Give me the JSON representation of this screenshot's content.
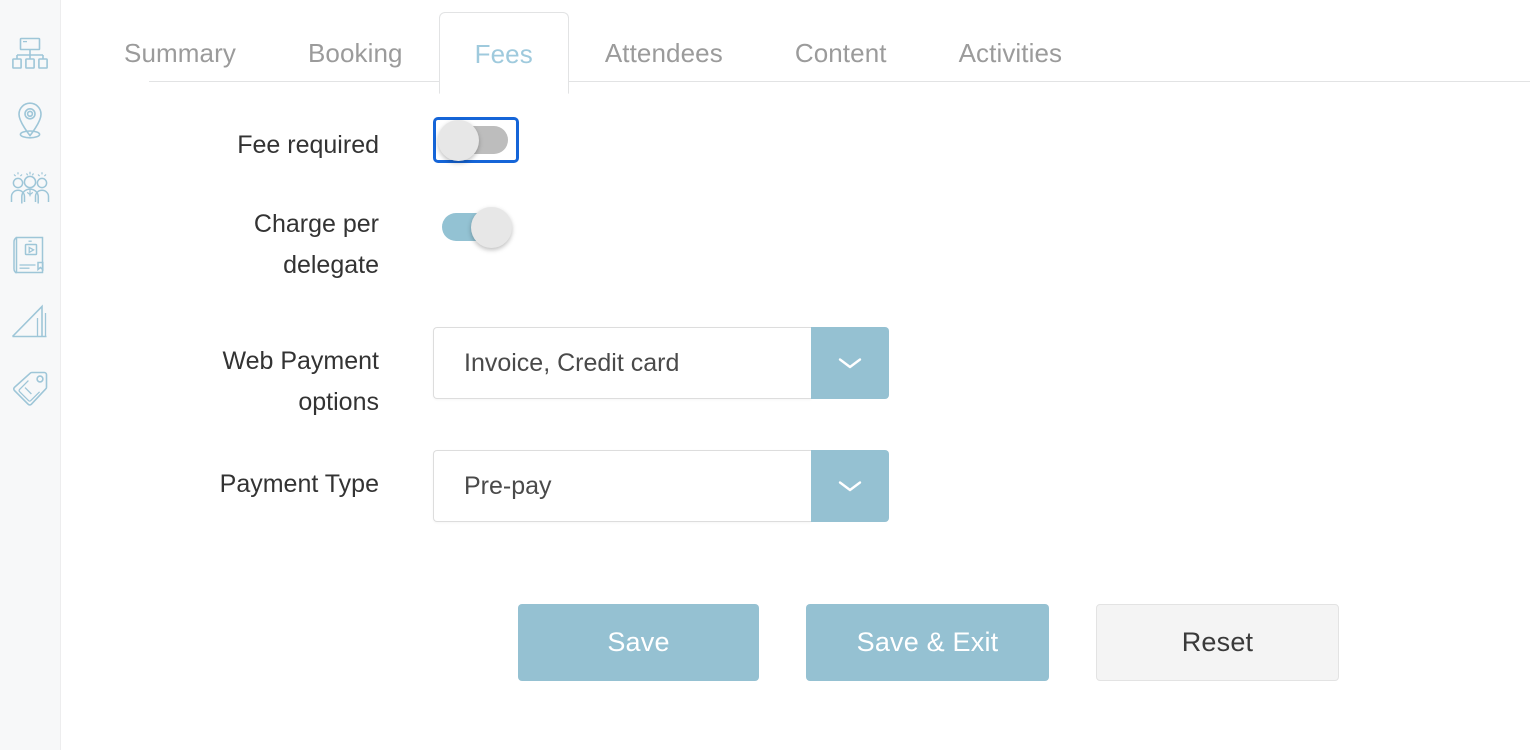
{
  "sidebar": {
    "items": [
      {
        "icon": "org-chart-icon",
        "name": "sidebar-item-structure"
      },
      {
        "icon": "map-pin-icon",
        "name": "sidebar-item-location"
      },
      {
        "icon": "people-group-icon",
        "name": "sidebar-item-attendees"
      },
      {
        "icon": "ebook-icon",
        "name": "sidebar-item-content"
      },
      {
        "icon": "ramp-chart-icon",
        "name": "sidebar-item-activities"
      },
      {
        "icon": "price-tag-icon",
        "name": "sidebar-item-fees"
      }
    ]
  },
  "tabs": {
    "items": [
      {
        "label": "Summary",
        "active": false
      },
      {
        "label": "Booking",
        "active": false
      },
      {
        "label": "Fees",
        "active": true
      },
      {
        "label": "Attendees",
        "active": false
      },
      {
        "label": "Content",
        "active": false
      },
      {
        "label": "Activities",
        "active": false
      }
    ],
    "active_label": "Fees"
  },
  "form": {
    "fee_required": {
      "label": "Fee required",
      "state": "off",
      "focused": true
    },
    "charge_per_delegate": {
      "label": "Charge per\ndelegate",
      "state": "on",
      "focused": false
    },
    "web_payment_options": {
      "label": "Web Payment\noptions",
      "value": "Invoice, Credit card",
      "chevron": "chevron-down-icon"
    },
    "payment_type": {
      "label": "Payment Type",
      "value": "Pre-pay",
      "chevron": "chevron-down-icon"
    }
  },
  "actions": {
    "save": "Save",
    "save_exit": "Save & Exit",
    "reset": "Reset"
  },
  "colors": {
    "accent": "#95c1d2",
    "tab_active_text": "#9fcadd",
    "focus_ring": "#1565d8",
    "toggle_off_track": "#bdbdbd",
    "toggle_on_track": "#93c2d3",
    "sidebar_bg": "#f7f8f9",
    "text_muted": "#9b9b9b"
  }
}
